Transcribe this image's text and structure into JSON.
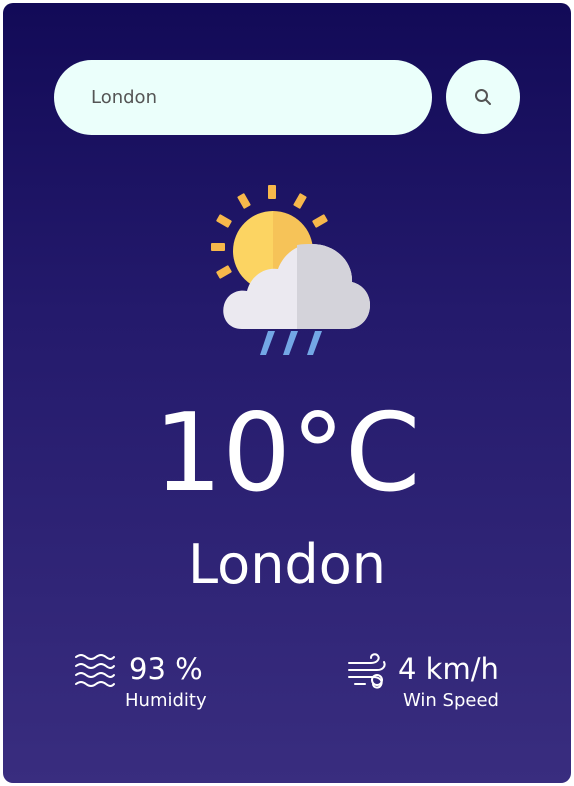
{
  "search": {
    "value": "London",
    "button_icon": "search-icon"
  },
  "weather": {
    "icon": "sun-cloud-rain-icon",
    "temperature": "10°C",
    "city": "London"
  },
  "details": {
    "humidity": {
      "icon": "humidity-waves-icon",
      "value": "93 %",
      "label": "Humidity"
    },
    "wind": {
      "icon": "wind-icon",
      "value": "4 km/h",
      "label": "Win Speed"
    }
  },
  "colors": {
    "gradient_top": "#120a57",
    "gradient_bottom": "#392d7f",
    "search_bg": "#ebfffb",
    "text": "#ffffff"
  }
}
